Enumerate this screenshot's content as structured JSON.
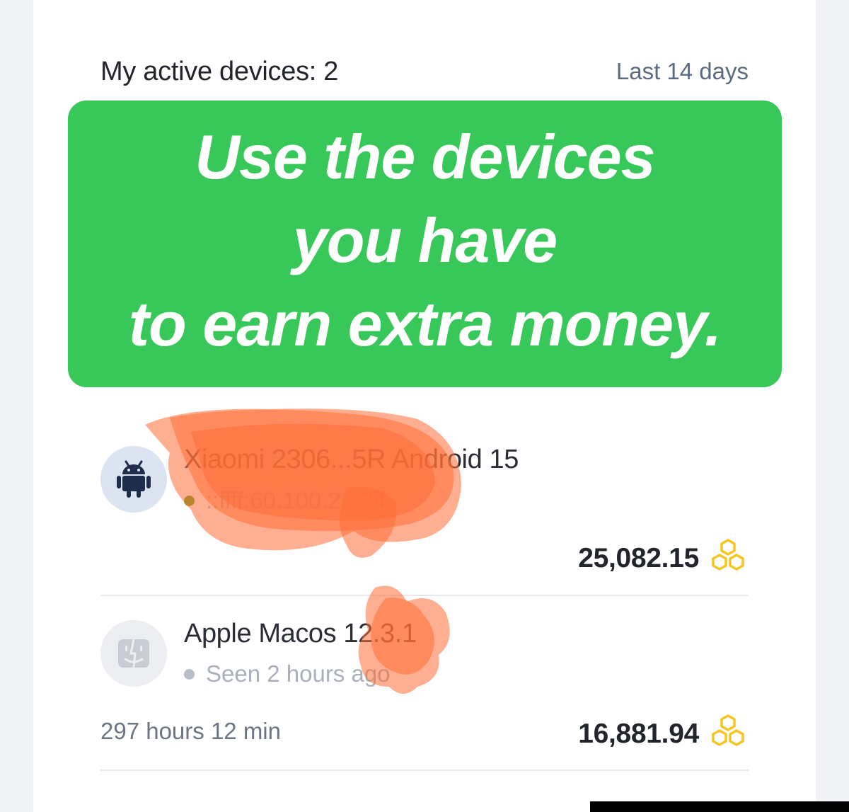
{
  "header": {
    "title": "My active devices: 2",
    "range_label": "Last 14 days"
  },
  "banner": {
    "lines": [
      "Use the devices",
      "you have",
      "to earn extra money."
    ]
  },
  "devices": [
    {
      "name": "Xiaomi 2306...5R Android 15",
      "icon": "android-icon",
      "status": "::ffff:60.100.2...34",
      "status_color": "#6aa520",
      "uptime": "",
      "amount": "25,082.15",
      "currency_icon": "hexagon-coin-icon"
    },
    {
      "name": "Apple Macos 12.3.1",
      "icon": "finder-icon",
      "status": "Seen 2 hours ago",
      "status_color": "#b8bec9",
      "uptime": "297 hours 12 min",
      "amount": "16,881.94",
      "currency_icon": "hexagon-coin-icon"
    }
  ],
  "colors": {
    "banner_green": "#38c759",
    "redaction_orange": "#ff7a45",
    "coin_gold": "#f5c520",
    "link_slate": "#5d6b82"
  }
}
